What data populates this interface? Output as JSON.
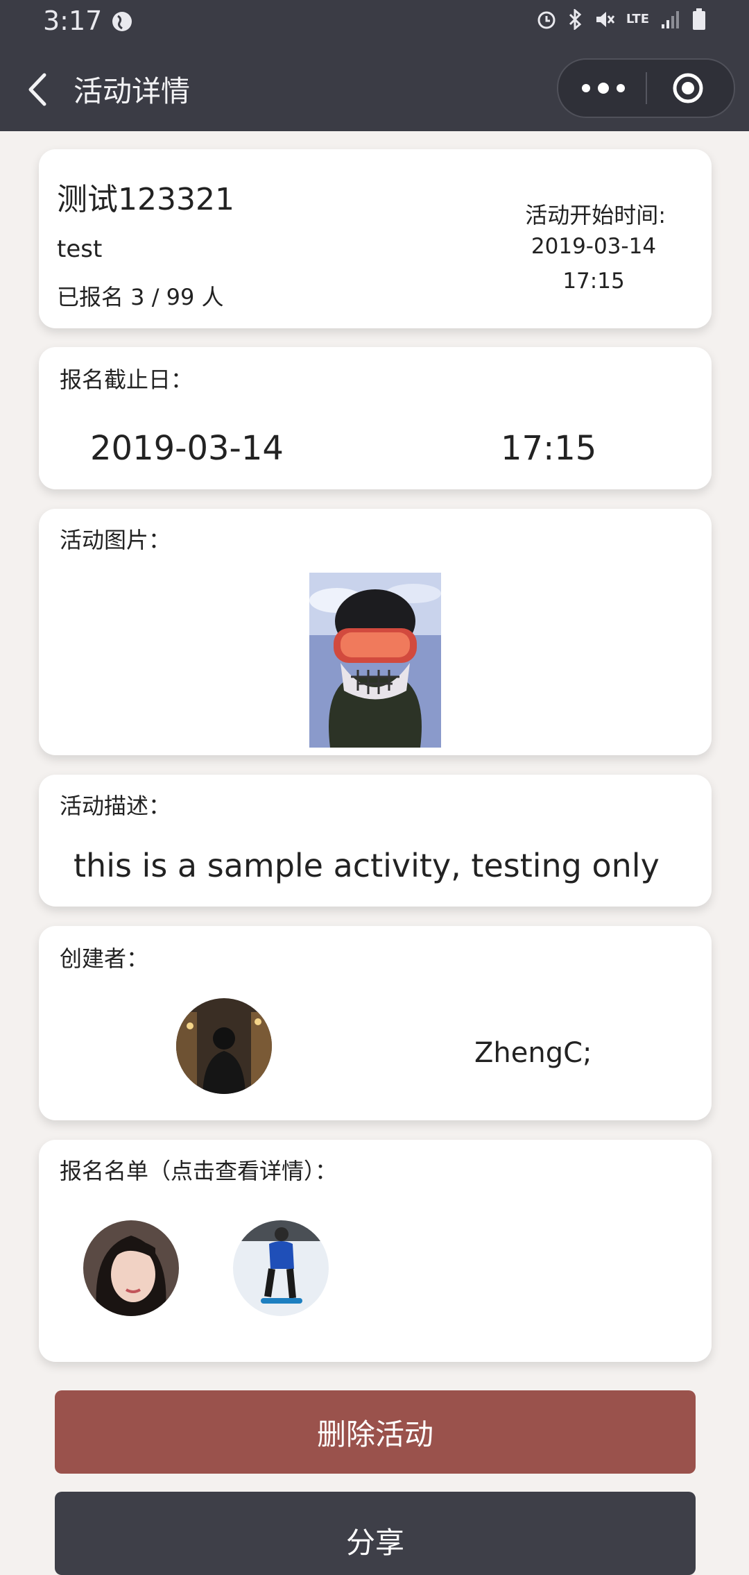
{
  "status_bar": {
    "time": "3:17",
    "network": "LTE",
    "icons": [
      "globe-icon",
      "alarm-icon",
      "bluetooth-icon",
      "mute-icon",
      "lte-icon",
      "signal-icon",
      "battery-icon"
    ]
  },
  "nav": {
    "title": "活动详情",
    "icons": [
      "back-icon",
      "more-icon",
      "target-icon"
    ]
  },
  "activity": {
    "title": "测试123321",
    "subtitle": "test",
    "signup_count": "已报名 3 / 99 人",
    "start_label": "活动开始时间:",
    "start_date": "2019-03-14",
    "start_time": "17:15"
  },
  "deadline": {
    "label": "报名截止日：",
    "date": "2019-03-14",
    "time": "17:15"
  },
  "image_section": {
    "label": "活动图片："
  },
  "description": {
    "label": "活动描述：",
    "text": "this is a sample activity, testing only"
  },
  "creator": {
    "label": "创建者：",
    "name": "ZhengC;"
  },
  "participants": {
    "label": "报名名单（点击查看详情）：",
    "count_shown": 2
  },
  "buttons": {
    "delete": "删除活动",
    "share": "分享"
  },
  "colors": {
    "header_bg": "#3b3c45",
    "delete_button": "#9a524c",
    "share_button": "#3e3f48",
    "page_bg": "#f4f1ef"
  }
}
